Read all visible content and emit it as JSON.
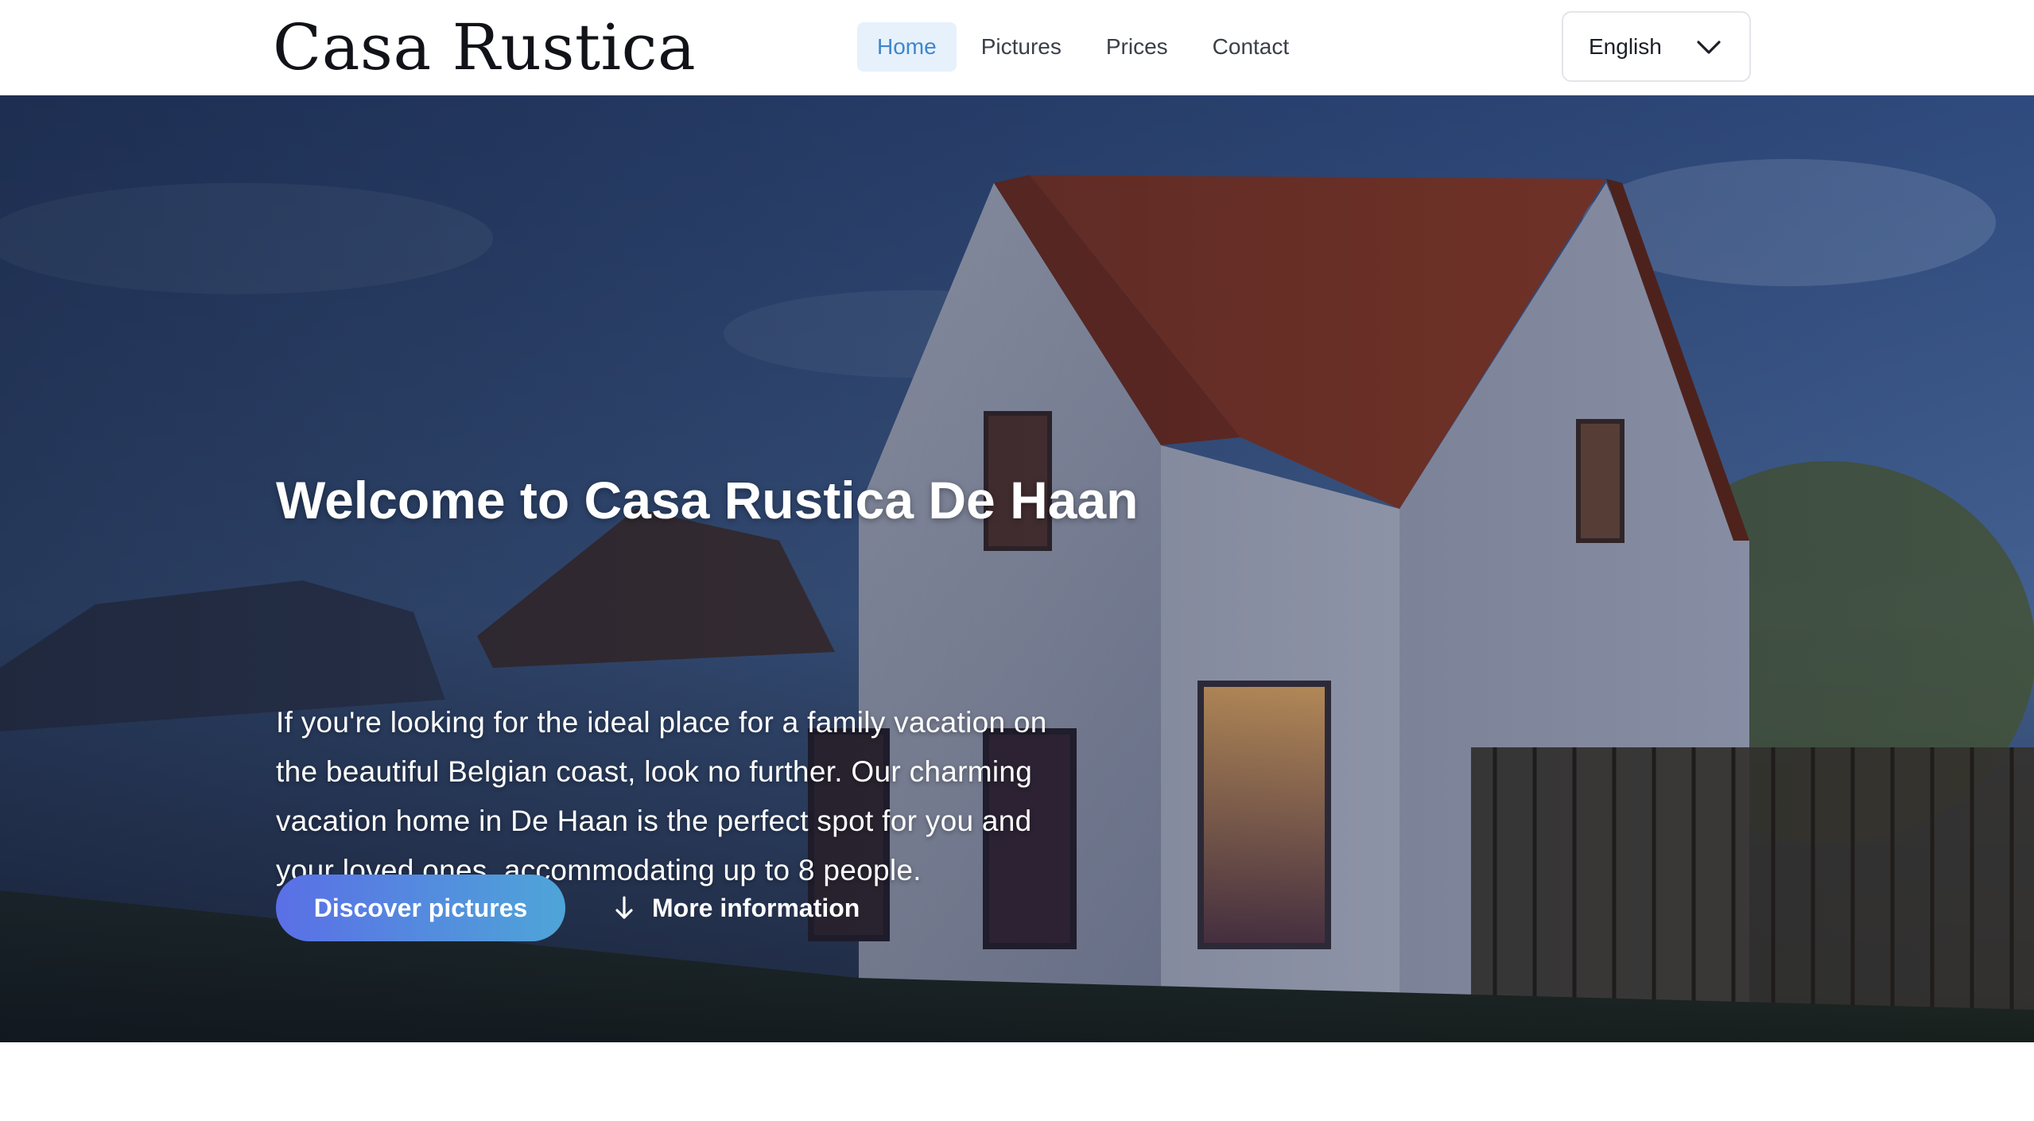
{
  "header": {
    "brand": "Casa Rustica",
    "nav": [
      {
        "label": "Home",
        "active": true
      },
      {
        "label": "Pictures",
        "active": false
      },
      {
        "label": "Prices",
        "active": false
      },
      {
        "label": "Contact",
        "active": false
      }
    ],
    "language": {
      "selected": "English",
      "icon": "chevron-down-icon"
    }
  },
  "hero": {
    "title": "Welcome to Casa Rustica De Haan",
    "text": "If you're looking for the ideal place for a family vacation on the beautiful Belgian coast, look no further. Our charming vacation home in De Haan is the perfect spot for you and your loved ones, accommodating up to 8 people.",
    "primary_button": "Discover pictures",
    "secondary_button": {
      "label": "More information",
      "icon": "arrow-down-icon"
    }
  },
  "colors": {
    "accent": "#3f86cc",
    "active_nav_bg": "#e6f1fb",
    "button_gradient_start": "#5a6fe6",
    "button_gradient_end": "#4ea5d8"
  }
}
